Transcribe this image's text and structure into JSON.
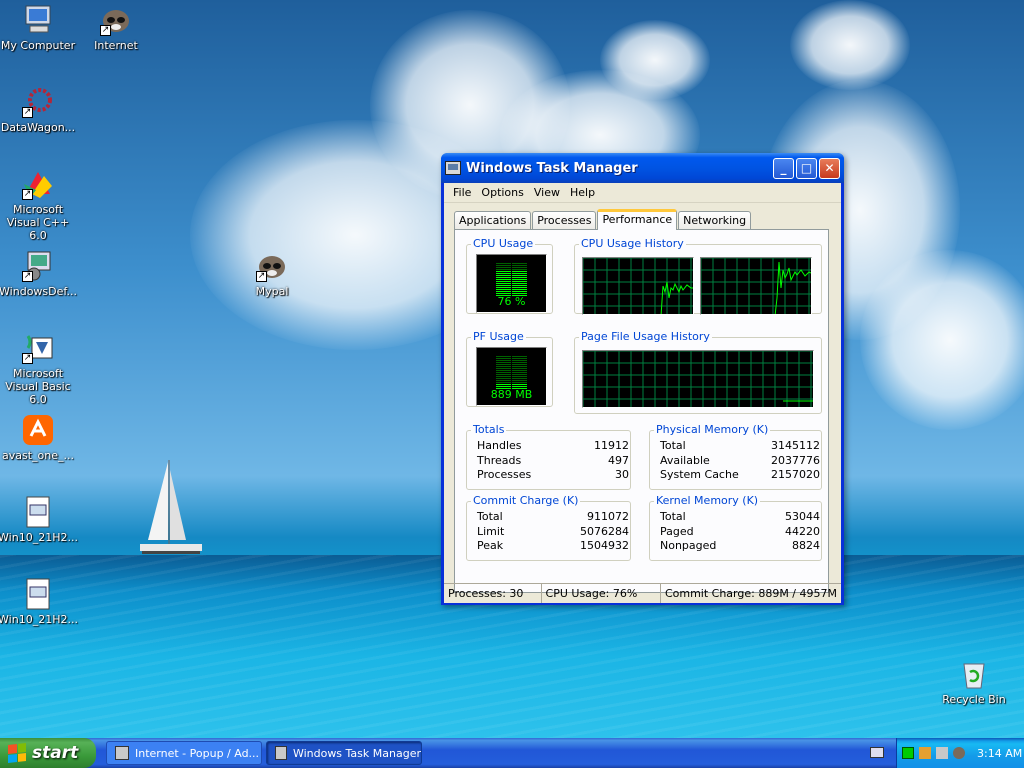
{
  "desktop": {
    "icons": [
      {
        "label": "My Computer"
      },
      {
        "label": "Internet"
      },
      {
        "label": "DataWagon..."
      },
      {
        "label": "Microsoft Visual C++ 6.0"
      },
      {
        "label": "WindowsDef..."
      },
      {
        "label": "Mypal"
      },
      {
        "label": "Microsoft Visual Basic 6.0"
      },
      {
        "label": "avast_one_..."
      },
      {
        "label": "Win10_21H2..."
      },
      {
        "label": "Win10_21H2..."
      },
      {
        "label": "Recycle Bin"
      }
    ]
  },
  "window": {
    "title": "Windows Task Manager",
    "menu": [
      "File",
      "Options",
      "View",
      "Help"
    ],
    "tabs": [
      "Applications",
      "Processes",
      "Performance",
      "Networking"
    ],
    "active_tab": "Performance",
    "cpu_usage": {
      "title": "CPU Usage",
      "value_label": "76 %",
      "percent": 76
    },
    "cpu_history": {
      "title": "CPU Usage History"
    },
    "pf_usage": {
      "title": "PF Usage",
      "value_label": "889 MB",
      "fraction": 0.18
    },
    "pf_history": {
      "title": "Page File Usage History"
    },
    "totals": {
      "title": "Totals",
      "rows": [
        [
          "Handles",
          "11912"
        ],
        [
          "Threads",
          "497"
        ],
        [
          "Processes",
          "30"
        ]
      ]
    },
    "physical_memory": {
      "title": "Physical Memory (K)",
      "rows": [
        [
          "Total",
          "3145112"
        ],
        [
          "Available",
          "2037776"
        ],
        [
          "System Cache",
          "2157020"
        ]
      ]
    },
    "commit_charge": {
      "title": "Commit Charge (K)",
      "rows": [
        [
          "Total",
          "911072"
        ],
        [
          "Limit",
          "5076284"
        ],
        [
          "Peak",
          "1504932"
        ]
      ]
    },
    "kernel_memory": {
      "title": "Kernel Memory (K)",
      "rows": [
        [
          "Total",
          "53044"
        ],
        [
          "Paged",
          "44220"
        ],
        [
          "Nonpaged",
          "8824"
        ]
      ]
    },
    "status": {
      "processes": "Processes: 30",
      "cpu": "CPU Usage: 76%",
      "commit": "Commit Charge: 889M / 4957M"
    }
  },
  "taskbar": {
    "start_label": "start",
    "items": [
      "Internet - Popup / Ad...",
      "Windows Task Manager"
    ],
    "clock": "3:14 AM"
  },
  "colors": {
    "graph_line": "#00ff00",
    "grid": "#008040",
    "group_title": "#0046d5"
  }
}
